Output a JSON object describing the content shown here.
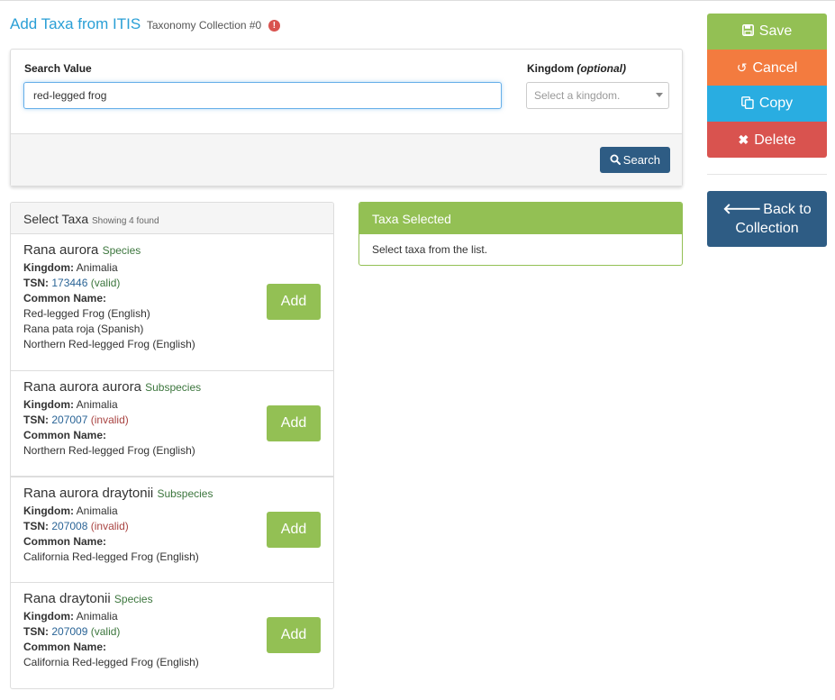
{
  "header": {
    "title": "Add Taxa from ITIS",
    "subtitle": "Taxonomy Collection #0",
    "alert_icon": "exclamation-circle-icon"
  },
  "search": {
    "value_label": "Search Value",
    "value": "red-legged frog",
    "kingdom_label": "Kingdom",
    "kingdom_optional": "(optional)",
    "kingdom_placeholder": "Select a kingdom.",
    "search_button": "Search",
    "search_icon": "search-icon"
  },
  "select_taxa": {
    "title": "Select Taxa",
    "count_text": "Showing 4 found",
    "labels": {
      "kingdom": "Kingdom:",
      "tsn": "TSN:",
      "common": "Common Name:"
    },
    "add_label": "Add",
    "items": [
      {
        "name": "Rana aurora",
        "rank": "Species",
        "kingdom": "Animalia",
        "tsn": "173446",
        "status": "(valid)",
        "common_names": [
          "Red-legged Frog (English)",
          "Rana pata roja (Spanish)",
          "Northern Red-legged Frog (English)"
        ]
      },
      {
        "name": "Rana aurora aurora",
        "rank": "Subspecies",
        "kingdom": "Animalia",
        "tsn": "207007",
        "status": "(invalid)",
        "common_names": [
          "Northern Red-legged Frog (English)"
        ]
      },
      {
        "name": "Rana aurora draytonii",
        "rank": "Subspecies",
        "kingdom": "Animalia",
        "tsn": "207008",
        "status": "(invalid)",
        "common_names": [
          "California Red-legged Frog (English)"
        ]
      },
      {
        "name": "Rana draytonii",
        "rank": "Species",
        "kingdom": "Animalia",
        "tsn": "207009",
        "status": "(valid)",
        "common_names": [
          "California Red-legged Frog (English)"
        ]
      }
    ]
  },
  "taxa_selected": {
    "title": "Taxa Selected",
    "empty_text": "Select taxa from the list."
  },
  "actions": {
    "save": "Save",
    "cancel": "Cancel",
    "copy": "Copy",
    "delete": "Delete",
    "back_line1": "Back to",
    "back_line2": "Collection"
  },
  "colors": {
    "title_blue": "#2a9fd6",
    "success_green": "#93c054",
    "warning_orange": "#f37b3f",
    "info_blue": "#29ade1",
    "danger_red": "#d9534f",
    "primary_navy": "#2e5c84"
  }
}
